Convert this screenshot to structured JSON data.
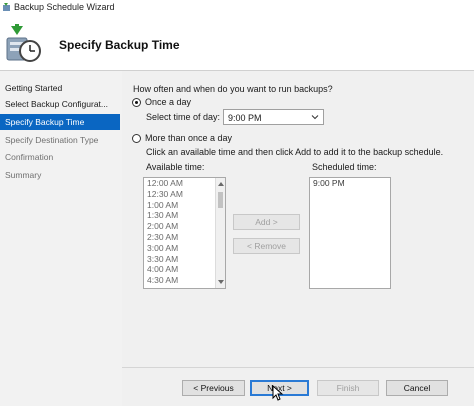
{
  "window": {
    "title": "Backup Schedule Wizard"
  },
  "header": {
    "title": "Specify Backup Time"
  },
  "nav": {
    "items": [
      {
        "label": "Getting Started",
        "state": "normal"
      },
      {
        "label": "Select Backup Configurat...",
        "state": "normal"
      },
      {
        "label": "Specify Backup Time",
        "state": "active"
      },
      {
        "label": "Specify Destination Type",
        "state": "disabled"
      },
      {
        "label": "Confirmation",
        "state": "disabled"
      },
      {
        "label": "Summary",
        "state": "disabled"
      }
    ]
  },
  "main": {
    "question": "How often and when do you want to run backups?",
    "once_label": "Once a day",
    "once_selected": true,
    "select_time_label": "Select time of day:",
    "select_time_value": "9:00 PM",
    "more_label": "More than once a day",
    "more_selected": false,
    "instruction": "Click an available time and then click Add to add it to the backup schedule.",
    "available_label": "Available time:",
    "available_times": [
      "12:00 AM",
      "12:30 AM",
      "1:00 AM",
      "1:30 AM",
      "2:00 AM",
      "2:30 AM",
      "3:00 AM",
      "3:30 AM",
      "4:00 AM",
      "4:30 AM"
    ],
    "scheduled_label": "Scheduled time:",
    "scheduled_times": [
      "9:00 PM"
    ],
    "add_label": "Add >",
    "remove_label": "< Remove"
  },
  "footer": {
    "previous_label": "< Previous",
    "next_label": "Next >",
    "finish_label": "Finish",
    "cancel_label": "Cancel"
  },
  "icons": {
    "title": "backup-app-icon",
    "header": "backup-schedule-clock-icon",
    "select": "chevron-down-icon",
    "cursor": "mouse-pointer-icon"
  },
  "colors": {
    "nav_active_bg": "#0a66c2",
    "nav_bg": "#f2f2f2",
    "content_bg": "#f0f0f0"
  }
}
